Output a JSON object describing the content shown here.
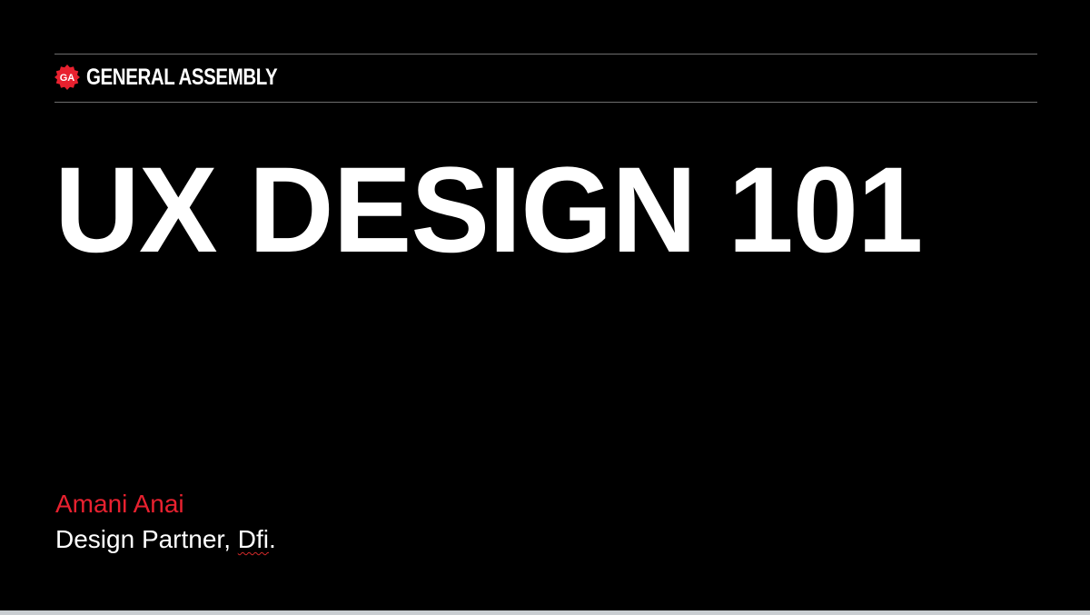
{
  "brand": {
    "logo_text": "GA",
    "name": "GENERAL ASSEMBLY",
    "accent_color": "#e8212f"
  },
  "slide": {
    "title": "UX DESIGN 101",
    "background_color": "#000000"
  },
  "presenter": {
    "name": "Amani Anai",
    "role_prefix": "Design Partner, ",
    "org": "Dfi",
    "role_suffix": ".",
    "name_color": "#e8212f"
  }
}
